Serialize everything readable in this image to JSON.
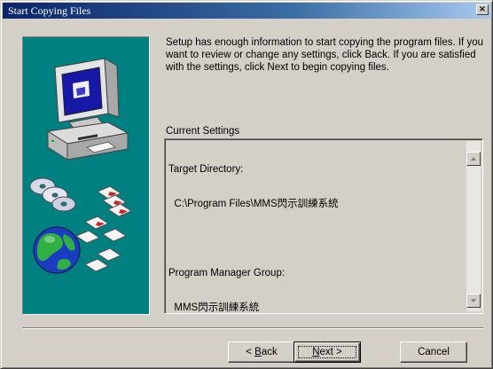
{
  "window": {
    "title": "Start Copying Files",
    "close_glyph": "×"
  },
  "intro_text": "Setup has enough information to start copying the program files. If you want to review or change any settings, click Back. If you are satisfied with the settings, click Next to begin copying files.",
  "current_settings": {
    "label": "Current Settings",
    "lines": [
      "Target Directory:",
      "  C:\\Program Files\\MMS閃示訓練系統",
      "",
      "Program Manager Group:",
      "  MMS閃示訓練系統"
    ]
  },
  "buttons": {
    "back_prefix": "< ",
    "back_accel": "B",
    "back_rest": "ack",
    "next_accel": "N",
    "next_rest": "ext >",
    "cancel": "Cancel"
  },
  "icons": {
    "artwork": "computer-cds-disks-globe-art",
    "scroll_up": "scroll-up-arrow-icon",
    "scroll_down": "scroll-down-arrow-icon"
  },
  "colors": {
    "title_bar_start": "#0a246a",
    "art_background": "#008080",
    "dialog_face": "#d4d0c8"
  }
}
